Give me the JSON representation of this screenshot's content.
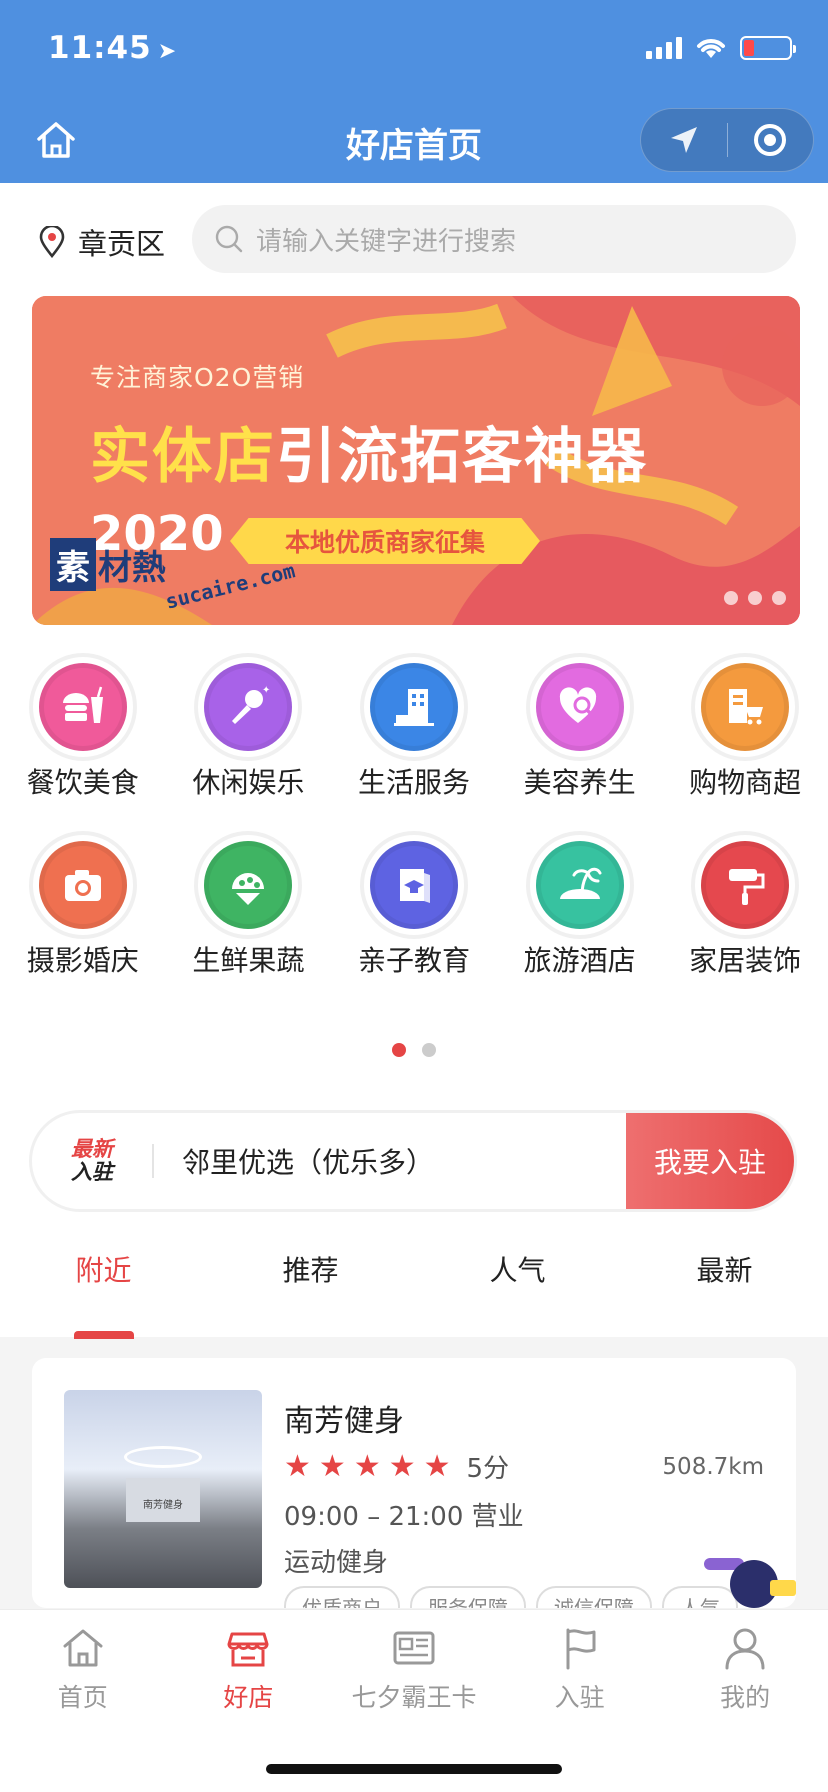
{
  "status_bar": {
    "time": "11:45"
  },
  "nav": {
    "title": "好店首页"
  },
  "location": {
    "district": "章贡区"
  },
  "search": {
    "placeholder": "请输入关键字进行搜索"
  },
  "banner": {
    "subtitle": "专注商家O2O营销",
    "title_highlight": "实体店",
    "title_rest": "引流拓客神器",
    "year": "2020",
    "ribbon": "本地优质商家征集",
    "watermark_logo_a": "素",
    "watermark_logo_b": "材熱",
    "watermark_url": "sucaire.com",
    "colors": {
      "background": "#ef7c63",
      "highlight": "#ffe14a",
      "ribbon": "#ffd84a"
    }
  },
  "categories": [
    {
      "label": "餐饮美食",
      "icon": "food-icon",
      "color": "#f05a9a"
    },
    {
      "label": "休闲娱乐",
      "icon": "microphone-icon",
      "color": "#a862e8"
    },
    {
      "label": "生活服务",
      "icon": "building-icon",
      "color": "#3b86e6"
    },
    {
      "label": "美容养生",
      "icon": "heart-search-icon",
      "color": "#e26be0"
    },
    {
      "label": "购物商超",
      "icon": "shopping-cart-icon",
      "color": "#f49a3e"
    },
    {
      "label": "摄影婚庆",
      "icon": "camera-icon",
      "color": "#ef7050"
    },
    {
      "label": "生鲜果蔬",
      "icon": "fruit-icon",
      "color": "#3fb463"
    },
    {
      "label": "亲子教育",
      "icon": "graduation-book-icon",
      "color": "#5e63e2"
    },
    {
      "label": "旅游酒店",
      "icon": "palm-island-icon",
      "color": "#37c2a0"
    },
    {
      "label": "家居装饰",
      "icon": "paint-roller-icon",
      "color": "#e5484e"
    }
  ],
  "category_pages": {
    "total": 2,
    "current": 1
  },
  "news": {
    "badge_line1": "最新",
    "badge_line2": "入驻",
    "text": "邻里优选（优乐多）",
    "button": "我要入驻"
  },
  "tabs": [
    {
      "label": "附近",
      "active": true
    },
    {
      "label": "推荐",
      "active": false
    },
    {
      "label": "人气",
      "active": false
    },
    {
      "label": "最新",
      "active": false
    }
  ],
  "store": {
    "name": "南芳健身",
    "rating_stars": 5,
    "score": "5分",
    "distance": "508.7km",
    "hours": "09:00 – 21:00 营业",
    "category": "运动健身",
    "image_sign": "南芳健身",
    "tags": [
      "优质商户",
      "服务保障",
      "诚信保障",
      "人气"
    ]
  },
  "tabbar": [
    {
      "label": "首页",
      "icon": "home-icon",
      "active": false
    },
    {
      "label": "好店",
      "icon": "store-icon",
      "active": true
    },
    {
      "label": "七夕霸王卡",
      "icon": "card-icon",
      "active": false
    },
    {
      "label": "入驻",
      "icon": "flag-icon",
      "active": false
    },
    {
      "label": "我的",
      "icon": "user-icon",
      "active": false
    }
  ],
  "colors": {
    "header": "#4f90e0",
    "accent": "#e54545"
  }
}
